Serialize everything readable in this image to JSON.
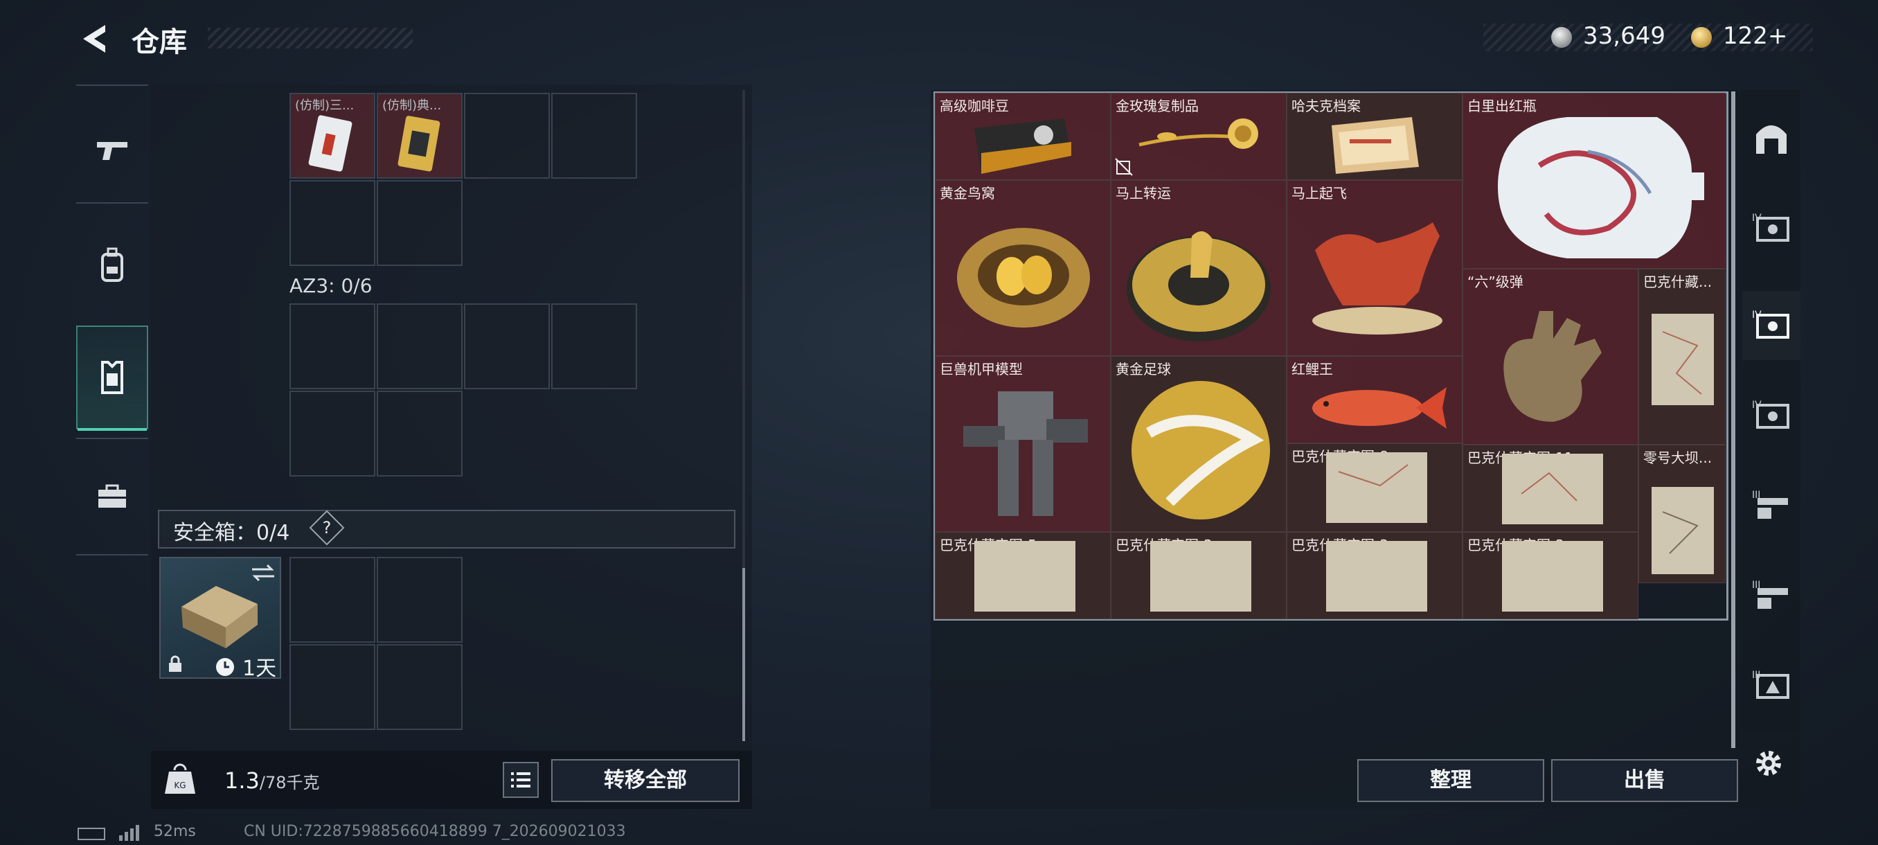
{
  "header": {
    "title": "仓库",
    "silver_value": "33,649",
    "gold_value": "122+"
  },
  "left_tabs": [
    "gun-icon",
    "backpack-icon",
    "vest-icon",
    "briefcase-icon"
  ],
  "left_panel": {
    "top_items": [
      {
        "label": "(仿制)三..."
      },
      {
        "label": "(仿制)典..."
      }
    ],
    "az3_label": "AZ3: 0/6",
    "safe_label": "安全箱：0/4",
    "safe_help": "?",
    "case_timer": "1天",
    "weight_value": "1.3",
    "weight_capacity": "/78千克",
    "transfer_all": "转移全部"
  },
  "right_grid": {
    "items": [
      {
        "label": "高级咖啡豆"
      },
      {
        "label": "金玫瑰复制品"
      },
      {
        "label": "哈夫克档案"
      },
      {
        "label": "白里出红瓶"
      },
      {
        "label": "黄金鸟窝"
      },
      {
        "label": "马上转运"
      },
      {
        "label": "马上起飞"
      },
      {
        "label": "“六”级弹"
      },
      {
        "label": "巴克什藏..."
      },
      {
        "label": "巨兽机甲模型"
      },
      {
        "label": "黄金足球"
      },
      {
        "label": "红鲤王"
      },
      {
        "label": "巴克什藏宝图-8"
      },
      {
        "label": "巴克什藏宝图-11"
      },
      {
        "label": "零号大坝..."
      },
      {
        "label": "巴克什藏宝图-5"
      },
      {
        "label": "巴克什藏宝图-2"
      },
      {
        "label": "巴克什藏宝图-3"
      },
      {
        "label": "巴克什藏宝图-2"
      }
    ]
  },
  "right_tabs": [
    "arch-icon",
    "tier4-case-icon",
    "tier5-case-icon",
    "tier4-case-icon",
    "tier3-case-icon",
    "tier3-case-icon",
    "tier2-case-icon"
  ],
  "buttons": {
    "sort": "整理",
    "sell": "出售"
  },
  "status": {
    "ping": "52ms",
    "uid": "CN UID:7228759885660418899 7_202609021033"
  },
  "colors": {
    "accent": "#4fd1b0",
    "item_bg": "#64242c"
  }
}
